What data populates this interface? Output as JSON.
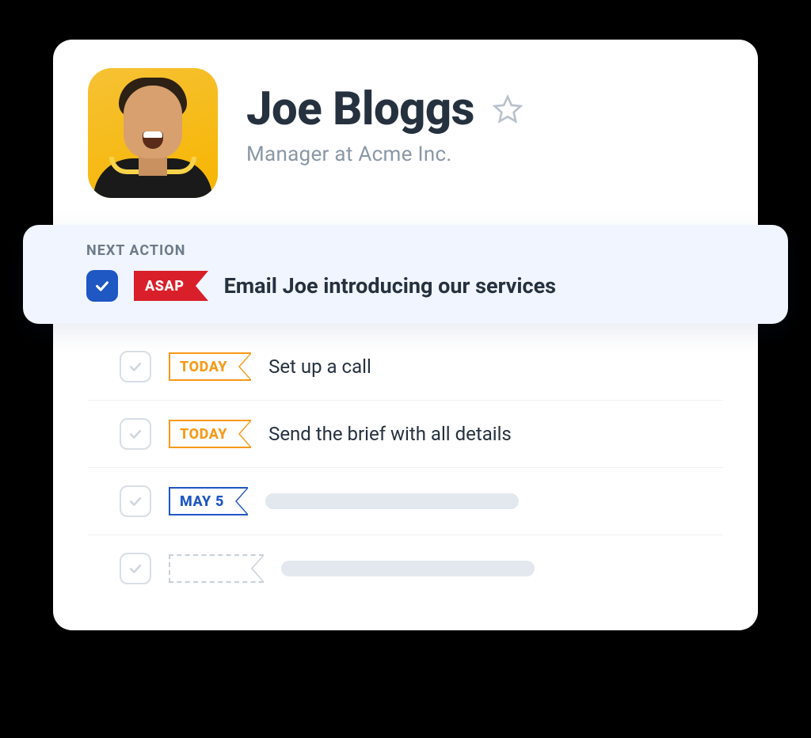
{
  "contact": {
    "name": "Joe Bloggs",
    "subtitle": "Manager at Acme Inc."
  },
  "next_action": {
    "label": "NEXT ACTION",
    "tag": "ASAP",
    "text": "Email Joe introducing our services"
  },
  "actions": [
    {
      "tag": "TODAY",
      "tag_style": "today",
      "text": "Set up a call",
      "placeholder": false
    },
    {
      "tag": "TODAY",
      "tag_style": "today",
      "text": "Send the brief with all details",
      "placeholder": false
    },
    {
      "tag": "MAY 5",
      "tag_style": "may",
      "text": "",
      "placeholder": true,
      "placeholder_width": 320
    },
    {
      "tag": "",
      "tag_style": "dashed",
      "text": "",
      "placeholder": true,
      "placeholder_width": 320
    }
  ]
}
